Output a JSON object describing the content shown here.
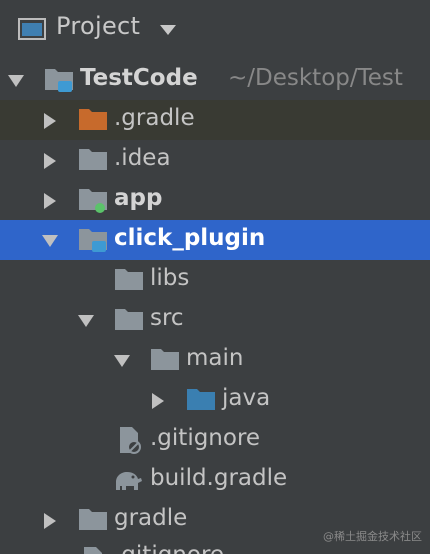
{
  "header": {
    "title": "Project",
    "icon": "project-window-icon",
    "caret": "chevron-down-icon"
  },
  "root": {
    "label": "TestCode",
    "path": "~/Desktop/Test"
  },
  "tree": {
    "gradle_dir": ".gradle",
    "idea": ".idea",
    "app": "app",
    "click_plugin": "click_plugin",
    "libs": "libs",
    "src": "src",
    "main": "main",
    "java": "java",
    "gitignore": ".gitignore",
    "build_gradle": "build.gradle",
    "gradle": "gradle",
    "partial": ".gitignore"
  },
  "colors": {
    "background": "#3c3f41",
    "selection": "#2f65ca",
    "folder": "#8c959c",
    "excluded_folder": "#c76a2c",
    "source_folder": "#3a7fb1",
    "module_badge": "#3e9ad3",
    "android_dot": "#5bc36a"
  },
  "watermark": "@稀土掘金技术社区"
}
